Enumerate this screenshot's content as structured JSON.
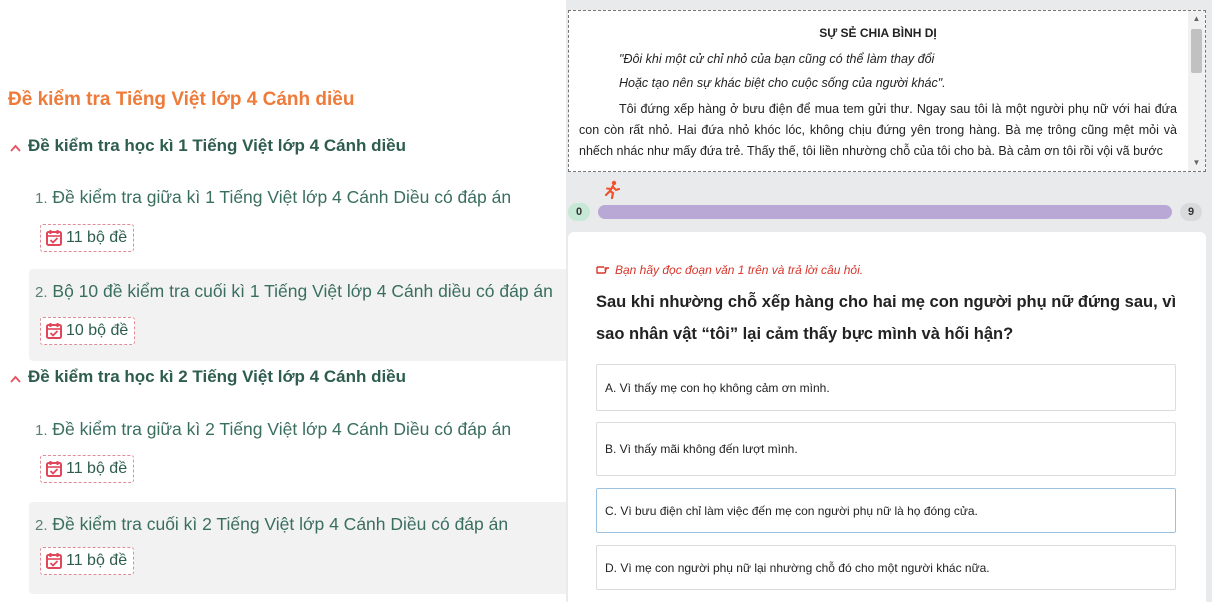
{
  "left": {
    "title": "Đề kiểm tra Tiếng Việt lớp 4 Cánh diều",
    "sections": [
      {
        "heading": "Đề kiểm tra học kì 1 Tiếng Việt lớp 4 Cánh diều",
        "items": [
          {
            "num": "1.",
            "title": "Đề kiểm tra giữa kì 1 Tiếng Việt lớp 4 Cánh Diều có đáp án",
            "badge": "11 bộ đề"
          },
          {
            "num": "2.",
            "title": "Bộ 10 đề kiểm tra cuối kì 1 Tiếng Việt lớp 4 Cánh diều có đáp án",
            "badge": "10 bộ đề"
          }
        ]
      },
      {
        "heading": "Đề kiểm tra học kì 2 Tiếng Việt lớp 4 Cánh diều",
        "items": [
          {
            "num": "1.",
            "title": "Đề kiểm tra giữa kì 2 Tiếng Việt lớp 4 Cánh Diều có đáp án",
            "badge": "11 bộ đề"
          },
          {
            "num": "2.",
            "title": "Đề kiểm tra cuối kì 2 Tiếng Việt lớp 4 Cánh Diều có đáp án",
            "badge": "11 bộ đề"
          }
        ]
      }
    ]
  },
  "reading": {
    "title": "SỰ SẺ CHIA BÌNH DỊ",
    "quote_1": "\"Đôi khi một cử chỉ nhỏ của bạn cũng có thể làm thay đổi",
    "quote_2": "Hoặc tạo nên sự khác biệt cho cuộc sống của người khác\".",
    "paragraph": "Tôi đứng xếp hàng ở bưu điện để mua tem gửi thư. Ngay sau tôi là một người phụ nữ với hai đứa con còn rất nhỏ. Hai đứa nhỏ khóc lóc, không chịu đứng yên trong hàng. Bà mẹ trông cũng mệt mỏi và nhếch nhác như mấy đứa trẻ. Thấy thế, tôi liền nhường chỗ của tôi cho bà. Bà cảm ơn tôi rồi vội vã bước"
  },
  "progress": {
    "current": "0",
    "total": "9",
    "fraction": 0.0,
    "colors": {
      "track": "#b9a8d6",
      "start_pill": "#c6e8d7",
      "runner": "#f0522b"
    }
  },
  "question": {
    "hint": "Bạn hãy đọc đoạn văn 1 trên và trả lời câu hỏi.",
    "text": "Sau khi nhường chỗ xếp hàng cho hai mẹ con người phụ nữ đứng sau, vì sao nhân vật “tôi” lại cảm thấy bực mình và hối hận?",
    "options": [
      "A. Vì thấy mẹ con họ không cảm ơn mình.",
      "B. Vì thấy mãi không đến lượt mình.",
      "C. Vì bưu điện chỉ làm việc đến mẹ con người phụ nữ là họ đóng cửa.",
      "D. Vì mẹ con người phụ nữ lại nhường chỗ đó cho một người khác nữa."
    ]
  },
  "icons": {
    "section_toggle": "chevron-up-icon",
    "badge": "calendar-check-icon",
    "runner": "running-person-icon",
    "hint": "pointing-hand-icon"
  },
  "theme": {
    "title_orange": "#ee7b3a",
    "heading_green": "#2e5d4f",
    "hint_red": "#d9352b"
  }
}
